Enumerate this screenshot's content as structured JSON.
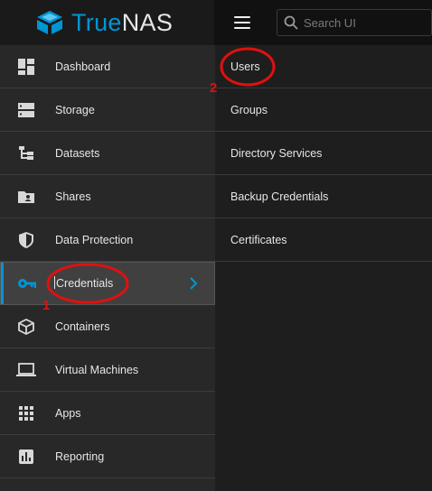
{
  "brand": {
    "true_text": "True",
    "nas_text": "NAS"
  },
  "search": {
    "placeholder": "Search UI"
  },
  "sidebar": {
    "items": [
      {
        "label": "Dashboard",
        "icon": "dashboard-icon"
      },
      {
        "label": "Storage",
        "icon": "storage-icon"
      },
      {
        "label": "Datasets",
        "icon": "datasets-icon"
      },
      {
        "label": "Shares",
        "icon": "shares-icon"
      },
      {
        "label": "Data Protection",
        "icon": "shield-icon"
      },
      {
        "label": "Credentials",
        "icon": "key-icon",
        "active": true
      },
      {
        "label": "Containers",
        "icon": "cube-icon"
      },
      {
        "label": "Virtual Machines",
        "icon": "laptop-icon"
      },
      {
        "label": "Apps",
        "icon": "apps-grid-icon"
      },
      {
        "label": "Reporting",
        "icon": "reporting-icon"
      }
    ]
  },
  "submenu": {
    "items": [
      {
        "label": "Users"
      },
      {
        "label": "Groups"
      },
      {
        "label": "Directory Services"
      },
      {
        "label": "Backup Credentials"
      },
      {
        "label": "Certificates"
      }
    ]
  },
  "annotations": {
    "step1": "1",
    "step2": "2"
  },
  "colors": {
    "accent": "#0095d5",
    "annotation": "#e01010",
    "sidebar_bg": "#282828",
    "active_bg": "#404040"
  }
}
